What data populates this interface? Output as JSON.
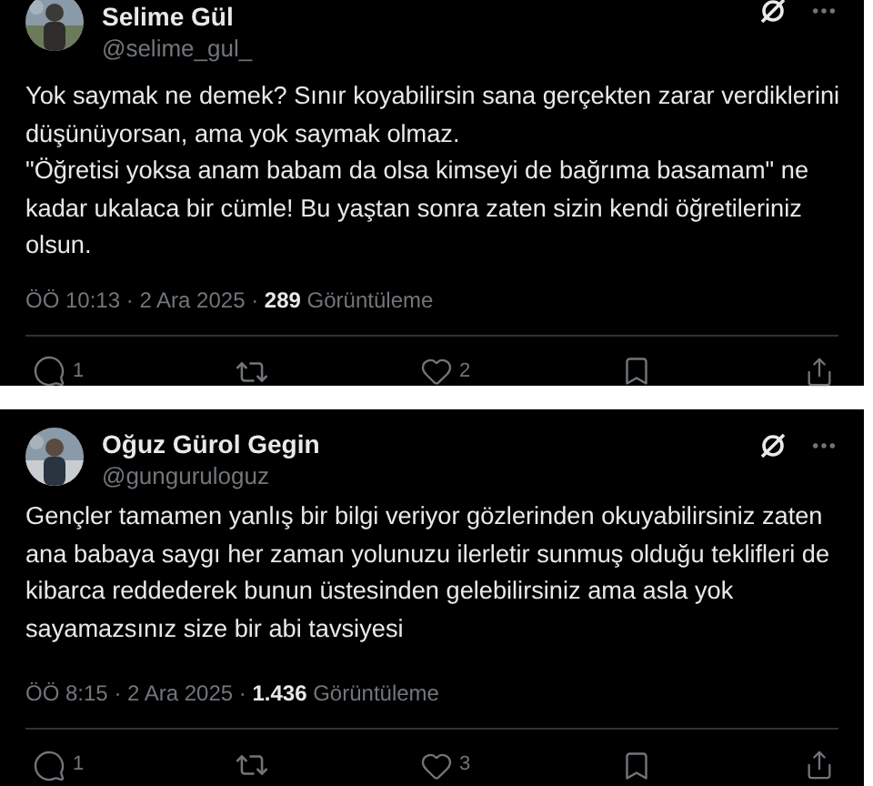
{
  "posts": [
    {
      "author": {
        "name": "Selime Gül",
        "handle": "@selime_gul_"
      },
      "body": "Yok saymak ne demek? Sınır koyabilirsin sana gerçekten zarar verdiklerini düşünüyorsan, ama yok saymak olmaz.\n\"Öğretisi yoksa anam babam da olsa kimseyi de bağrıma basamam\" ne kadar ukalaca bir cümle! Bu yaştan sonra zaten sizin kendi öğretileriniz olsun.",
      "time": "ÖÖ 10:13 · 2 Ara 2025 · ",
      "views": "289",
      "views_label": " Görüntüleme",
      "replies": "1",
      "likes": "2"
    },
    {
      "author": {
        "name": "Oğuz Gürol Gegin",
        "handle": "@gunguruloguz"
      },
      "body": "Gençler tamamen yanlış bir bilgi veriyor gözlerinden okuyabilirsiniz zaten ana babaya saygı her zaman yolunuzu ilerletir sunmuş olduğu teklifleri de kibarca reddederek bunun üstesinden gelebilirsiniz ama asla yok sayamazsınız size bir abi tavsiyesi",
      "time": "ÖÖ 8:15 · 2 Ara 2025 · ",
      "views": "1.436",
      "views_label": " Görüntüleme",
      "replies": "1",
      "likes": "3"
    }
  ]
}
